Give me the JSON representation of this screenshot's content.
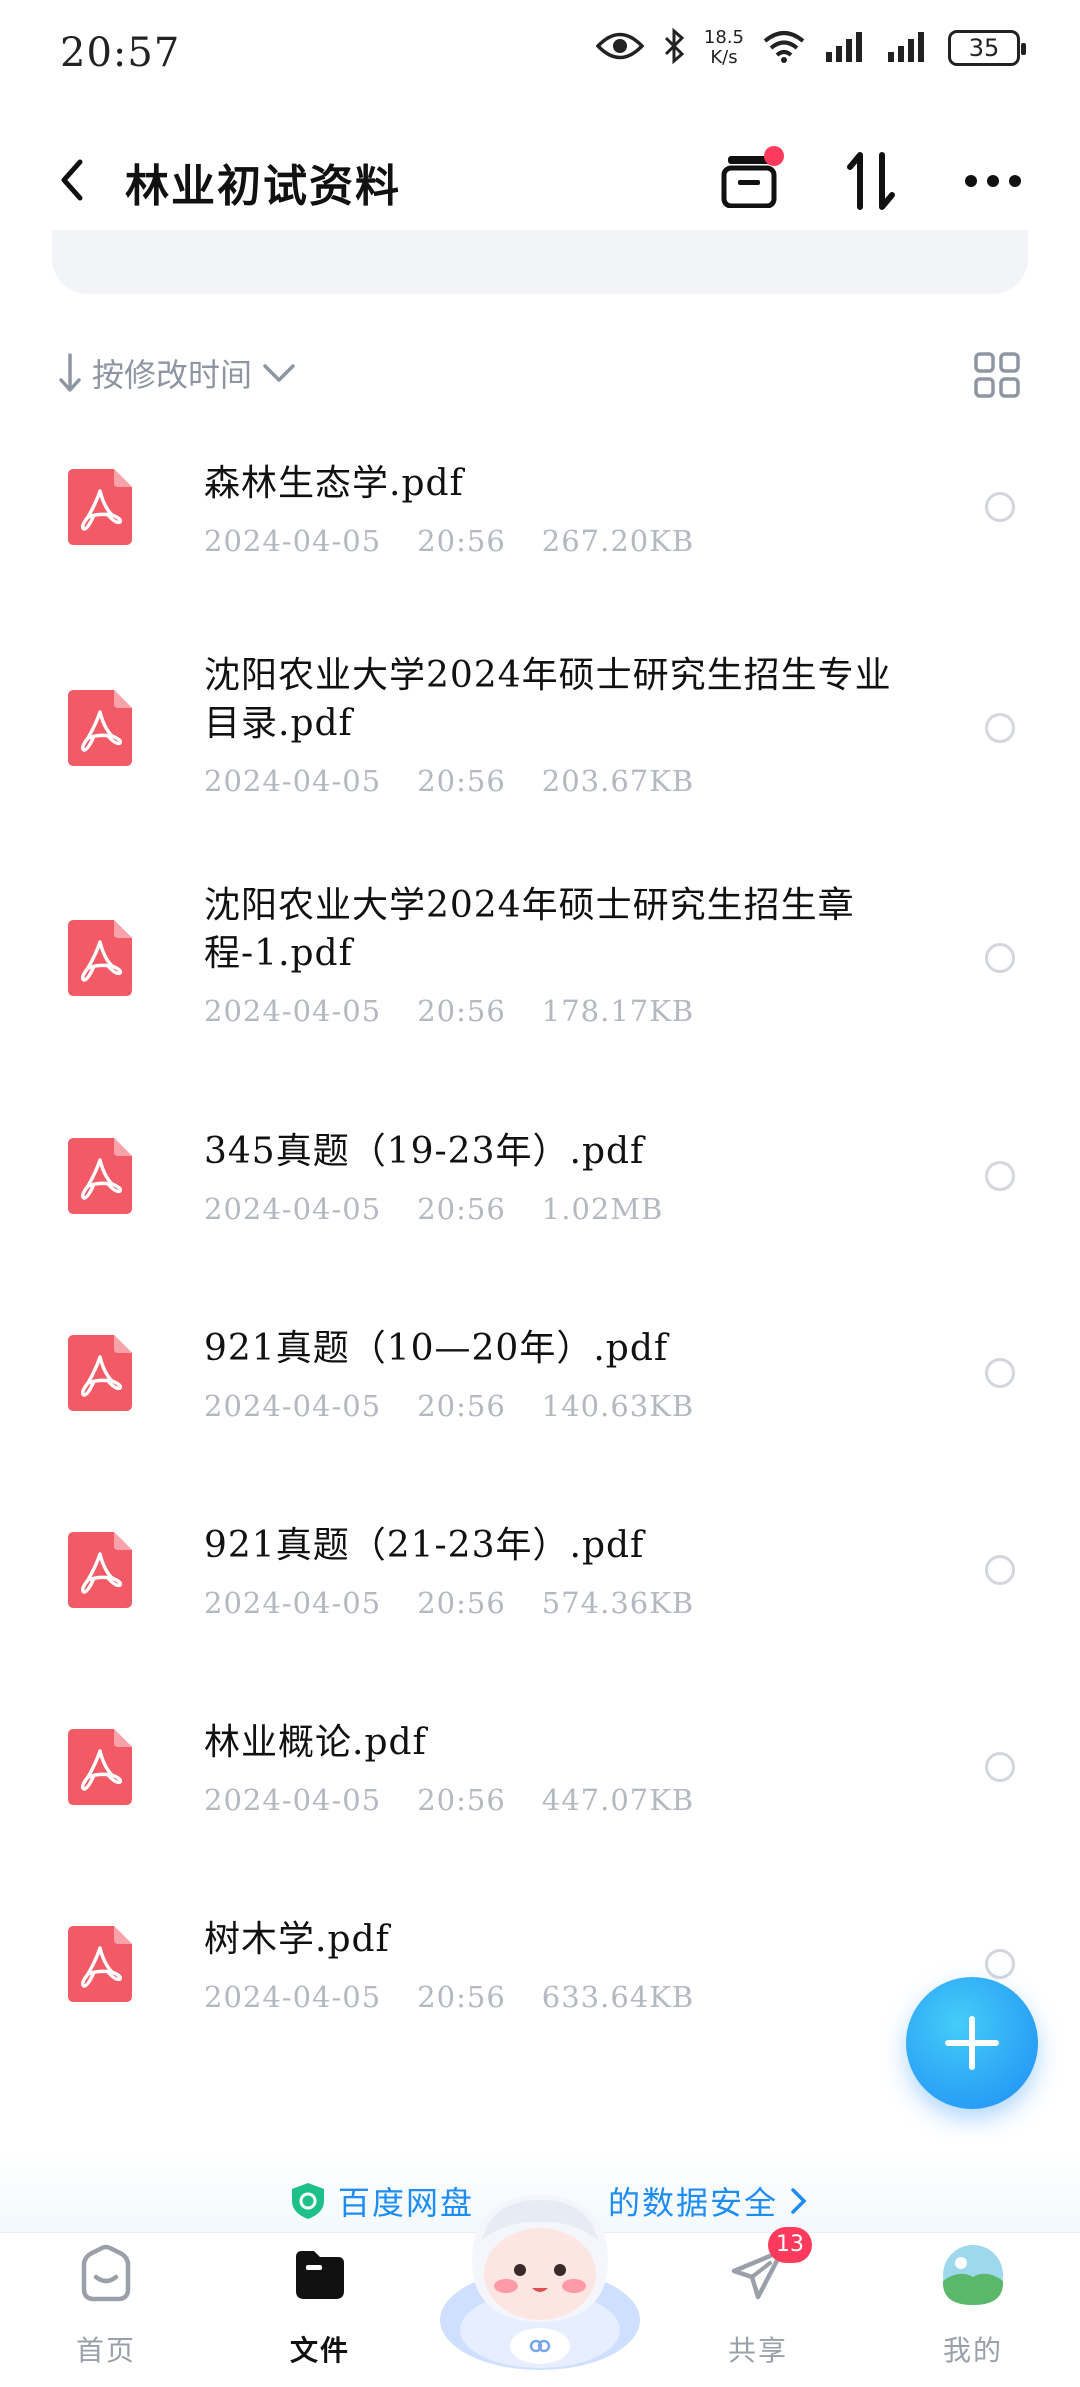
{
  "status_bar": {
    "time": "20:57",
    "speed_value": "18.5",
    "speed_unit": "K/s",
    "battery": "35"
  },
  "header": {
    "title": "林业初试资料",
    "back_icon": "chevron-left-icon",
    "actions": [
      "archive-icon",
      "sort-transfer-icon",
      "more-icon"
    ]
  },
  "sort": {
    "label": "按修改时间"
  },
  "files": [
    {
      "name": "森林生态学.pdf",
      "date": "2024-04-05",
      "time": "20:56",
      "size": "267.20KB"
    },
    {
      "name": "沈阳农业大学2024年硕士研究生招生专业目录.pdf",
      "date": "2024-04-05",
      "time": "20:56",
      "size": "203.67KB"
    },
    {
      "name": "沈阳农业大学2024年硕士研究生招生章程-1.pdf",
      "date": "2024-04-05",
      "time": "20:56",
      "size": "178.17KB"
    },
    {
      "name": "345真题（19-23年）.pdf",
      "date": "2024-04-05",
      "time": "20:56",
      "size": "1.02MB"
    },
    {
      "name": "921真题（10—20年）.pdf",
      "date": "2024-04-05",
      "time": "20:56",
      "size": "140.63KB"
    },
    {
      "name": "921真题（21-23年）.pdf",
      "date": "2024-04-05",
      "time": "20:56",
      "size": "574.36KB"
    },
    {
      "name": "林业概论.pdf",
      "date": "2024-04-05",
      "time": "20:56",
      "size": "447.07KB"
    },
    {
      "name": "树木学.pdf",
      "date": "2024-04-05",
      "time": "20:56",
      "size": "633.64KB"
    }
  ],
  "banner": {
    "text_left": "百度网盘",
    "text_right": "的数据安全"
  },
  "nav": {
    "home": "首页",
    "files": "文件",
    "share": "共享",
    "share_badge": "13",
    "mine": "我的"
  },
  "colors": {
    "accent": "#1e8cf5",
    "pdf_red": "#f25a66",
    "badge": "#ff3a5c"
  }
}
